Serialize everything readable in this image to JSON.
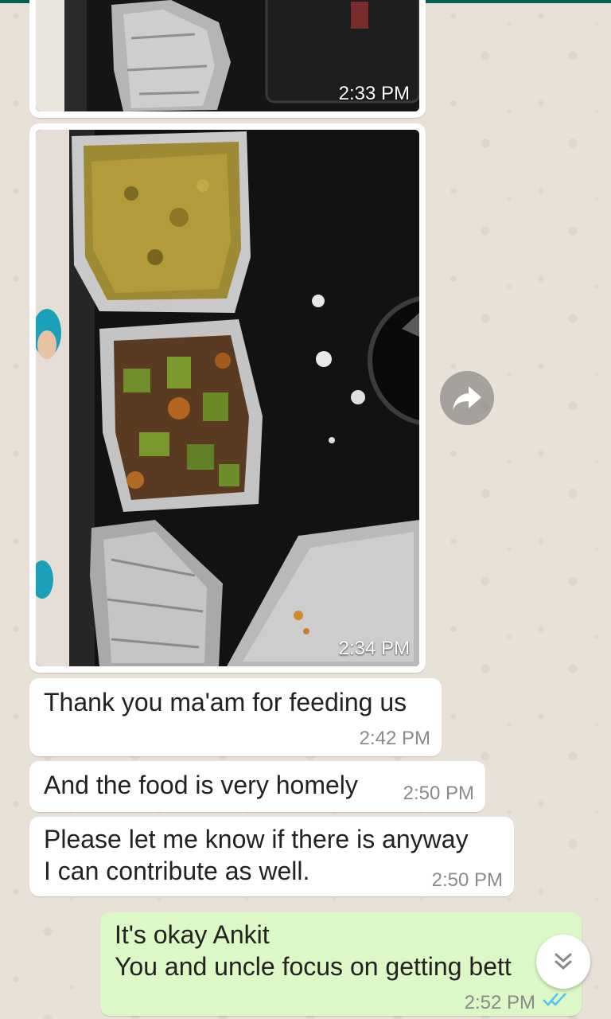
{
  "colors": {
    "incoming_bubble": "#ffffff",
    "outgoing_bubble": "#dcf8c6",
    "read_ticks": "#4fc3f7",
    "header": "#075e54"
  },
  "messages": [
    {
      "type": "image",
      "direction": "incoming",
      "time": "2:33 PM"
    },
    {
      "type": "image",
      "direction": "incoming",
      "time": "2:34 PM"
    },
    {
      "type": "text",
      "direction": "incoming",
      "text": "Thank you ma'am for feeding us",
      "time": "2:42 PM"
    },
    {
      "type": "text",
      "direction": "incoming",
      "text": "And the food is very homely",
      "time": "2:50 PM"
    },
    {
      "type": "text",
      "direction": "incoming",
      "text": "Please let me know if there is anyway\nI can contribute as well.",
      "time": "2:50 PM"
    },
    {
      "type": "text",
      "direction": "outgoing",
      "text": "It's okay Ankit\nYou and uncle focus on getting bett",
      "time": "2:52 PM",
      "status": "read"
    }
  ],
  "icons": {
    "forward": "forward-arrow-icon",
    "scroll_down": "double-chevron-down-icon",
    "read_status": "double-check-icon"
  }
}
